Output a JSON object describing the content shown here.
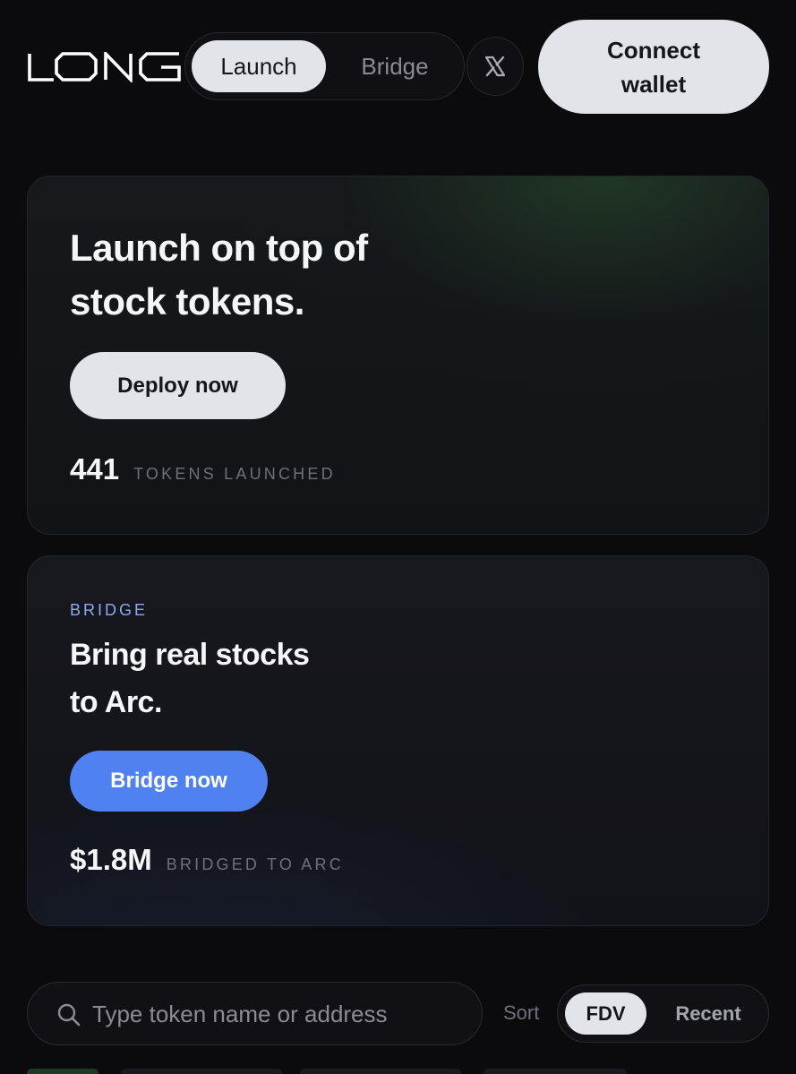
{
  "header": {
    "logo_text": "LONG",
    "nav_tabs": [
      {
        "label": "Launch",
        "active": true
      },
      {
        "label": "Bridge",
        "active": false
      }
    ],
    "x_icon": "x-twitter-icon",
    "connect_line1": "Connect",
    "connect_line2": "wallet"
  },
  "launch_card": {
    "title_line1": "Launch on top of",
    "title_line2": "stock tokens.",
    "button_label": "Deploy now",
    "stat_value": "441",
    "stat_label": "TOKENS LAUNCHED"
  },
  "bridge_card": {
    "eyebrow": "BRIDGE",
    "title_line1": "Bring real stocks",
    "title_line2": "to Arc.",
    "button_label": "Bridge now",
    "stat_value": "$1.8M",
    "stat_label": "BRIDGED TO ARC"
  },
  "search": {
    "placeholder": "Type token name or address",
    "value": "",
    "icon": "search-icon"
  },
  "sort": {
    "label": "Sort",
    "options": [
      {
        "label": "FDV",
        "active": true
      },
      {
        "label": "Recent",
        "active": false
      }
    ]
  },
  "colors": {
    "accent_blue": "#4f82f0",
    "eyebrow_blue": "#8ea9f0",
    "pill_light": "#e3e4ea",
    "background": "#0b0b0e"
  }
}
